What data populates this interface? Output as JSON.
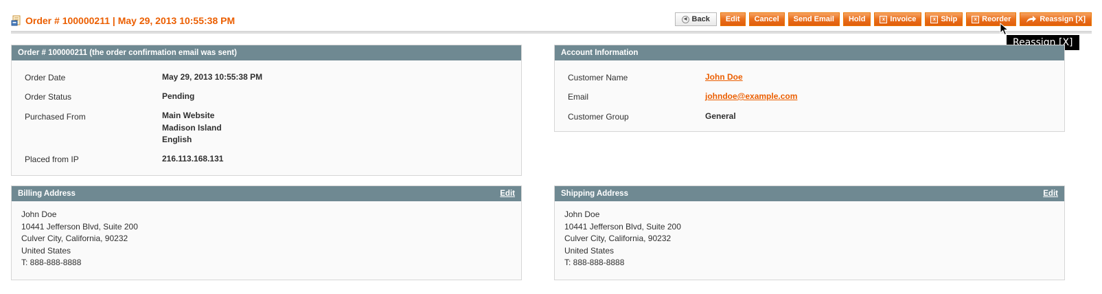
{
  "header": {
    "title": "Order # 100000211 | May 29, 2013 10:55:38 PM",
    "buttons": {
      "back": "Back",
      "edit": "Edit",
      "cancel": "Cancel",
      "send_email": "Send Email",
      "hold": "Hold",
      "invoice": "Invoice",
      "ship": "Ship",
      "reorder": "Reorder",
      "reassign": "Reassign [X]"
    }
  },
  "tooltip": "Reassign [X]",
  "order_box": {
    "title": "Order # 100000211 (the order confirmation email was sent)",
    "rows": [
      {
        "label": "Order Date",
        "value": "May 29, 2013 10:55:38 PM"
      },
      {
        "label": "Order Status",
        "value": "Pending"
      },
      {
        "label": "Purchased From",
        "value_lines": [
          "Main Website",
          "Madison Island",
          "English"
        ]
      },
      {
        "label": "Placed from IP",
        "value": "216.113.168.131"
      }
    ]
  },
  "account_box": {
    "title": "Account Information",
    "rows": [
      {
        "label": "Customer Name",
        "value": "John Doe"
      },
      {
        "label": "Email",
        "value": "johndoe@example.com"
      },
      {
        "label": "Customer Group",
        "value": "General"
      }
    ]
  },
  "billing_box": {
    "title": "Billing Address",
    "edit": "Edit",
    "lines": [
      "John Doe",
      "10441 Jefferson Blvd, Suite 200",
      "Culver City, California, 90232",
      "United States",
      "T: 888-888-8888"
    ]
  },
  "shipping_box": {
    "title": "Shipping Address",
    "edit": "Edit",
    "lines": [
      "John Doe",
      "10441 Jefferson Blvd, Suite 200",
      "Culver City, California, 90232",
      "United States",
      "T: 888-888-8888"
    ]
  },
  "colors": {
    "accent": "#eb5e00",
    "box_header": "#6f8992",
    "button": "#ea6f1c"
  },
  "icons": {
    "page": "order-document-icon",
    "back": "back-arrow-icon",
    "doc": "document-action-icon",
    "reassign": "share-arrow-icon",
    "cursor": "mouse-cursor-icon"
  }
}
